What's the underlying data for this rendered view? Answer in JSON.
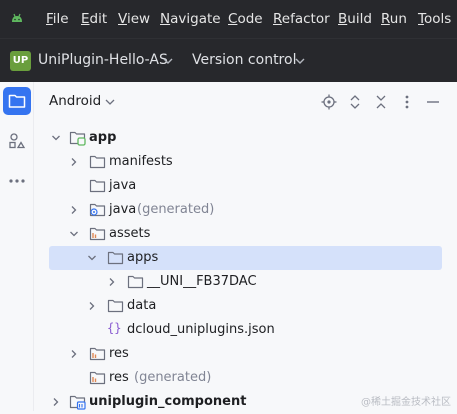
{
  "menubar": {
    "logo_icon": "android-studio-icon",
    "items": [
      {
        "m": "F",
        "r": "ile"
      },
      {
        "m": "E",
        "r": "dit"
      },
      {
        "m": "V",
        "r": "iew"
      },
      {
        "m": "N",
        "r": "avigate"
      },
      {
        "m": "C",
        "r": "ode"
      },
      {
        "m": "R",
        "r": "efactor"
      },
      {
        "m": "B",
        "r": "uild"
      },
      {
        "m": "R",
        "r": "un"
      },
      {
        "m": "T",
        "r": "ools"
      }
    ]
  },
  "project_bar": {
    "badge": "UP",
    "badge_color": "#6a9e3d",
    "project_name": "UniPlugin-Hello-AS",
    "vcs_label": "Version control"
  },
  "tool_strip": {
    "icons": [
      "project-folder-icon",
      "structure-icon",
      "more-tools-icon"
    ]
  },
  "panel": {
    "title": "Android",
    "toolbar_icons": [
      "locate-icon",
      "expand-all-icon",
      "collapse-all-icon",
      "options-icon",
      "hide-icon"
    ]
  },
  "tree": [
    {
      "label": "app",
      "sub": "",
      "bold": true,
      "expanded": true,
      "has_arrow": true,
      "icon": "module-folder-icon"
    },
    {
      "label": "manifests",
      "sub": "",
      "bold": false,
      "expanded": false,
      "has_arrow": true,
      "icon": "folder-icon"
    },
    {
      "label": "java",
      "sub": "",
      "bold": false,
      "expanded": false,
      "has_arrow": false,
      "icon": "folder-icon"
    },
    {
      "label": "java",
      "sub": "(generated)",
      "bold": false,
      "expanded": false,
      "has_arrow": true,
      "icon": "generated-folder-icon"
    },
    {
      "label": "assets",
      "sub": "",
      "bold": false,
      "expanded": true,
      "has_arrow": true,
      "icon": "resource-folder-icon"
    },
    {
      "label": "apps",
      "sub": "",
      "bold": false,
      "expanded": true,
      "has_arrow": true,
      "icon": "folder-icon",
      "selected": true
    },
    {
      "label": "__UNI__FB37DAC",
      "sub": "",
      "bold": false,
      "expanded": false,
      "has_arrow": true,
      "icon": "folder-icon"
    },
    {
      "label": "data",
      "sub": "",
      "bold": false,
      "expanded": false,
      "has_arrow": true,
      "icon": "folder-icon"
    },
    {
      "label": "dcloud_uniplugins.json",
      "sub": "",
      "bold": false,
      "expanded": false,
      "has_arrow": false,
      "icon": "json-file-icon"
    },
    {
      "label": "res",
      "sub": "",
      "bold": false,
      "expanded": false,
      "has_arrow": true,
      "icon": "resource-folder-icon"
    },
    {
      "label": "res",
      "sub": "(generated)",
      "bold": false,
      "expanded": false,
      "has_arrow": false,
      "icon": "resource-folder-icon"
    },
    {
      "label": "uniplugin_component",
      "sub": "",
      "bold": true,
      "expanded": false,
      "has_arrow": true,
      "icon": "library-module-icon"
    }
  ],
  "watermark": "@稀土掘金技术社区",
  "colors": {
    "accent": "#3574f0",
    "selection": "#d5e1fa",
    "menubar_bg": "#27282c"
  }
}
